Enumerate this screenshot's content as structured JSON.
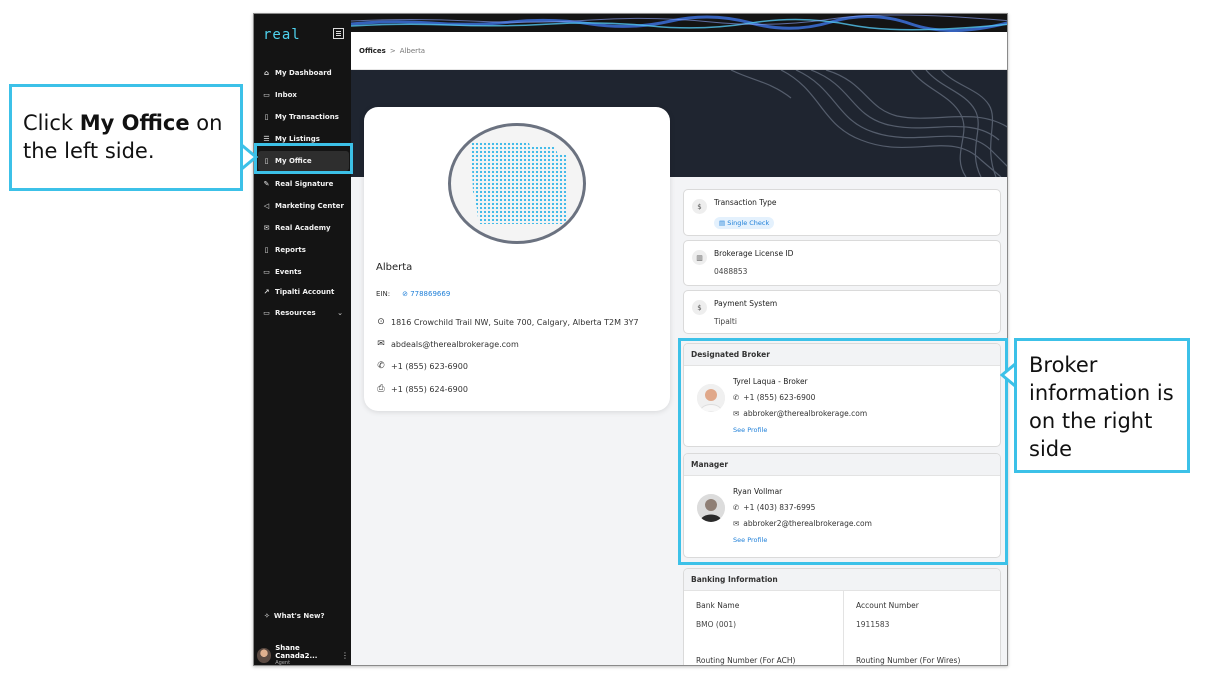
{
  "app": {
    "logo": "real",
    "breadcrumb": {
      "parent": "Offices",
      "separator": ">",
      "current": "Alberta"
    }
  },
  "sidebar": {
    "items": [
      {
        "label": "My Dashboard",
        "icon": "home-icon",
        "glyph": "⌂"
      },
      {
        "label": "Inbox",
        "icon": "inbox-icon",
        "glyph": "▭"
      },
      {
        "label": "My Transactions",
        "icon": "transactions-icon",
        "glyph": "▯"
      },
      {
        "label": "My Listings",
        "icon": "listings-icon",
        "glyph": "☰"
      },
      {
        "label": "My Office",
        "icon": "office-icon",
        "glyph": "▯",
        "active": true
      },
      {
        "label": "Real Signature",
        "icon": "signature-icon",
        "glyph": "✎"
      },
      {
        "label": "Marketing Center",
        "icon": "megaphone-icon",
        "glyph": "◁"
      },
      {
        "label": "Real Academy",
        "icon": "academy-icon",
        "glyph": "✉"
      },
      {
        "label": "Reports",
        "icon": "reports-icon",
        "glyph": "▯"
      },
      {
        "label": "Events",
        "icon": "calendar-icon",
        "glyph": "▭"
      },
      {
        "label": "Tipalti Account",
        "icon": "external-link-icon",
        "glyph": "↗"
      },
      {
        "label": "Resources",
        "icon": "folder-icon",
        "glyph": "▭",
        "chevron": "⌄"
      }
    ],
    "whats_new": "What's New?",
    "user": {
      "name": "Shane Canada2...",
      "role": "Agent"
    }
  },
  "office": {
    "name": "Alberta",
    "ein_label": "EIN:",
    "ein_value": "778869669",
    "address": "1816 Crowchild Trail NW, Suite 700, Calgary, Alberta T2M 3Y7",
    "email": "abdeals@therealbrokerage.com",
    "phone": "+1 (855) 623-6900",
    "fax": "+1 (855) 624-6900"
  },
  "details": {
    "transaction_type": {
      "label": "Transaction Type",
      "value": "Single Check"
    },
    "license": {
      "label": "Brokerage License ID",
      "value": "0488853"
    },
    "payment": {
      "label": "Payment System",
      "value": "Tipalti"
    }
  },
  "designated_broker": {
    "heading": "Designated Broker",
    "name": "Tyrel Laqua - Broker",
    "phone": "+1 (855) 623-6900",
    "email": "abbroker@therealbrokerage.com",
    "link": "See Profile"
  },
  "manager": {
    "heading": "Manager",
    "name": "Ryan Vollmar",
    "phone": "+1 (403) 837-6995",
    "email": "abbroker2@therealbrokerage.com",
    "link": "See Profile"
  },
  "banking": {
    "heading": "Banking Information",
    "bank_name_label": "Bank Name",
    "bank_name": "BMO (001)",
    "account_label": "Account Number",
    "account": "1911583",
    "routing_ach_label": "Routing Number (For ACH)",
    "routing_wires_label": "Routing Number (For Wires)"
  },
  "callouts": {
    "left_pre": "Click ",
    "left_bold": "My Office",
    "left_post": " on the left side.",
    "right": "Broker information is on the right side"
  },
  "colors": {
    "accent": "#3cc1e8",
    "link": "#1e7fd8",
    "sidebar_bg": "#141414",
    "hero_bg": "#1f2530"
  }
}
